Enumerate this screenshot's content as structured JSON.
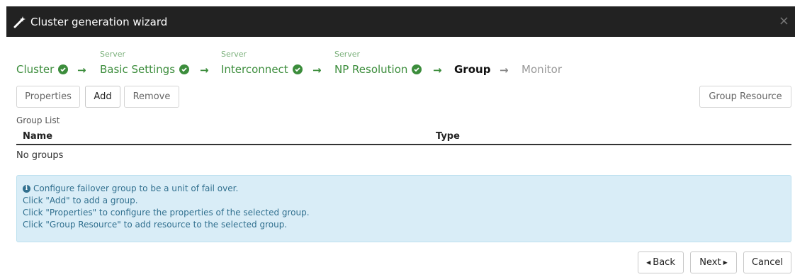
{
  "window": {
    "title": "Cluster generation wizard",
    "close_glyph": "×"
  },
  "steps": [
    {
      "sup": "",
      "label": "Cluster",
      "status": "done"
    },
    {
      "sup": "Server",
      "label": "Basic Settings",
      "status": "done"
    },
    {
      "sup": "Server",
      "label": "Interconnect",
      "status": "done"
    },
    {
      "sup": "Server",
      "label": "NP Resolution",
      "status": "done"
    },
    {
      "sup": "",
      "label": "Group",
      "status": "current"
    },
    {
      "sup": "",
      "label": "Monitor",
      "status": "future"
    }
  ],
  "toolbar": {
    "properties": "Properties",
    "add": "Add",
    "remove": "Remove",
    "group_resource": "Group Resource"
  },
  "group_list": {
    "label": "Group List",
    "columns": [
      "Name",
      "Type"
    ],
    "empty_text": "No groups"
  },
  "info": {
    "lines": [
      "Configure failover group to be a unit of fail over.",
      "Click \"Add\" to add a group.",
      "Click \"Properties\" to configure the properties of the selected group.",
      "Click \"Group Resource\" to add resource to the selected group."
    ]
  },
  "footer": {
    "back": "Back",
    "next": "Next",
    "cancel": "Cancel"
  },
  "colors": {
    "titlebar": "#222222",
    "step_done": "#3c8d3c",
    "info_bg": "#d9edf7",
    "info_text": "#31708f"
  }
}
